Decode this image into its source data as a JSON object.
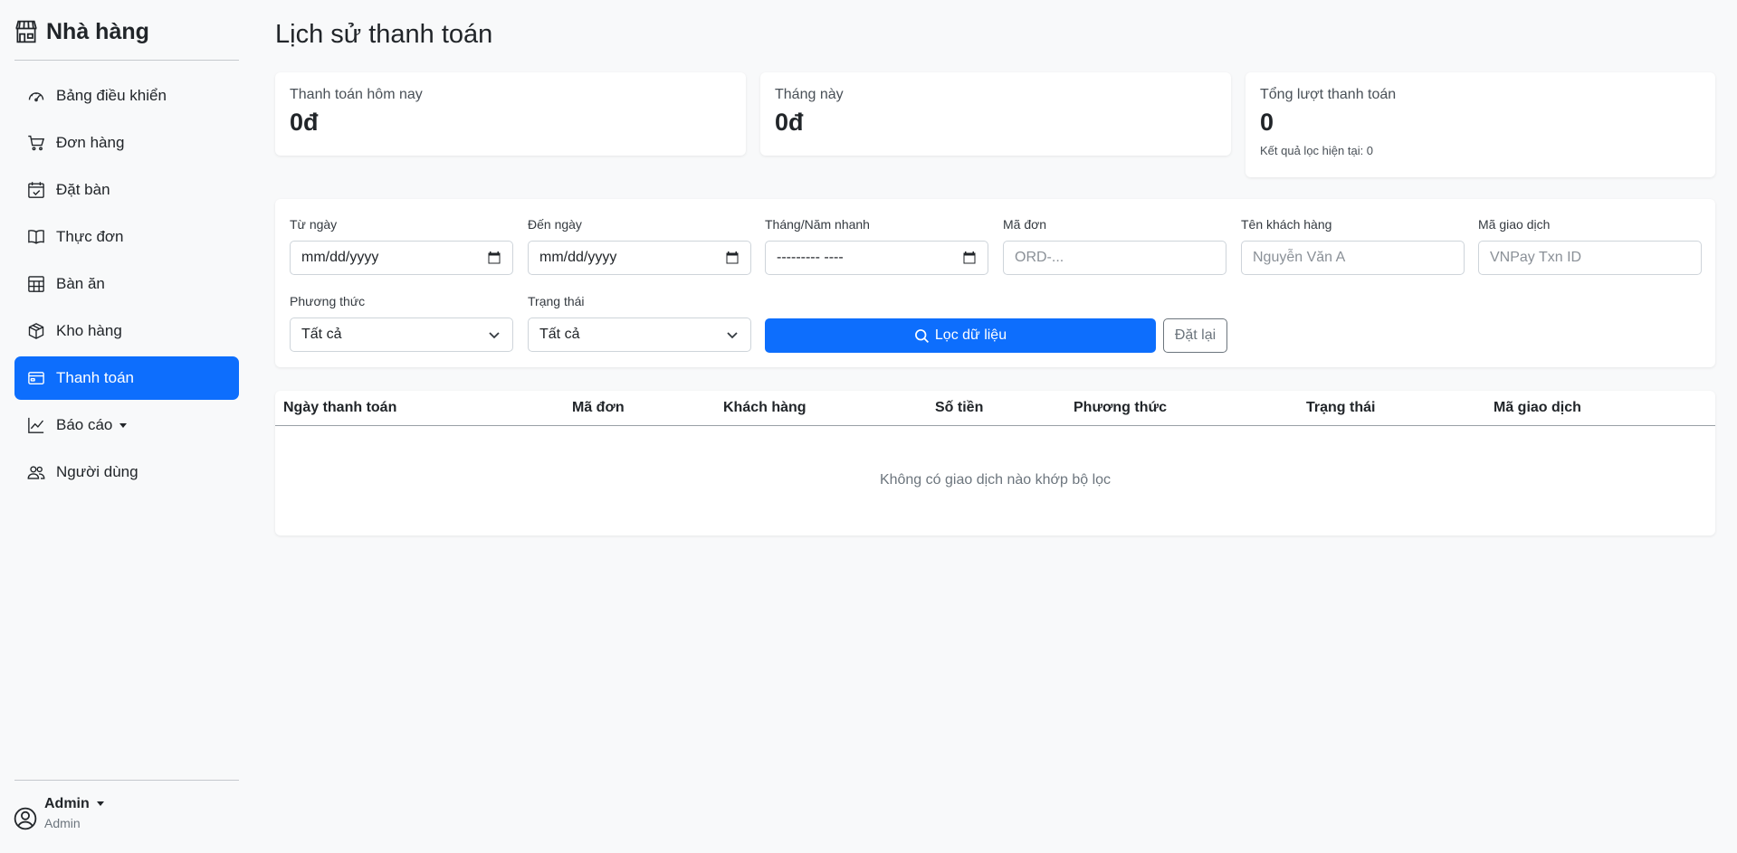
{
  "sidebar": {
    "brand": "Nhà hàng",
    "items": [
      {
        "label": "Bảng điều khiển",
        "icon": "speedometer-icon"
      },
      {
        "label": "Đơn hàng",
        "icon": "cart-icon"
      },
      {
        "label": "Đặt bàn",
        "icon": "calendar-check-icon"
      },
      {
        "label": "Thực đơn",
        "icon": "book-icon"
      },
      {
        "label": "Bàn ăn",
        "icon": "table-icon"
      },
      {
        "label": "Kho hàng",
        "icon": "box-icon"
      },
      {
        "label": "Thanh toán",
        "icon": "credit-card-icon",
        "active": true
      },
      {
        "label": "Báo cáo",
        "icon": "chart-icon",
        "dropdown": true
      },
      {
        "label": "Người dùng",
        "icon": "people-icon"
      }
    ],
    "user": {
      "name": "Admin",
      "role": "Admin"
    }
  },
  "main": {
    "title": "Lịch sử thanh toán",
    "stats": [
      {
        "label": "Thanh toán hôm nay",
        "value": "0đ"
      },
      {
        "label": "Tháng này",
        "value": "0đ"
      },
      {
        "label": "Tổng lượt thanh toán",
        "value": "0",
        "sub": "Kết quả lọc hiện tại: 0"
      }
    ],
    "filters": {
      "from_date": {
        "label": "Từ ngày",
        "value": "mm/dd/yyyy"
      },
      "to_date": {
        "label": "Đến ngày",
        "value": "mm/dd/yyyy"
      },
      "month_year": {
        "label": "Tháng/Năm nhanh",
        "value": "--------- ----"
      },
      "order_code": {
        "label": "Mã đơn",
        "placeholder": "ORD-..."
      },
      "customer_name": {
        "label": "Tên khách hàng",
        "placeholder": "Nguyễn Văn A"
      },
      "txn_id": {
        "label": "Mã giao dịch",
        "placeholder": "VNPay Txn ID"
      },
      "method": {
        "label": "Phương thức",
        "value": "Tất cả"
      },
      "status": {
        "label": "Trạng thái",
        "value": "Tất cả"
      },
      "filter_button": "Lọc dữ liệu",
      "reset_button": "Đặt lại"
    },
    "table": {
      "columns": [
        "Ngày thanh toán",
        "Mã đơn",
        "Khách hàng",
        "Số tiền",
        "Phương thức",
        "Trạng thái",
        "Mã giao dịch"
      ],
      "empty_text": "Không có giao dịch nào khớp bộ lọc"
    }
  },
  "colors": {
    "accent": "#0d6efd",
    "background": "#f8f9fa",
    "card": "#ffffff"
  }
}
